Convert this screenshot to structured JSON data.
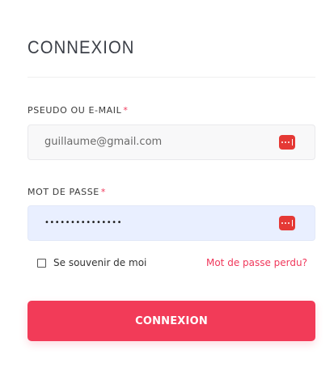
{
  "form": {
    "title": "CONNEXION",
    "username": {
      "label": "PSEUDO OU E-MAIL",
      "required_mark": "*",
      "value": "guillaume@gmail.com",
      "icon": "password-manager-icon"
    },
    "password": {
      "label": "MOT DE PASSE",
      "required_mark": "*",
      "value": "•••••••••••••••",
      "icon": "password-manager-icon"
    },
    "remember_me": {
      "label": "Se souvenir de moi",
      "checked": false
    },
    "forgot_password": "Mot de passe perdu?",
    "submit_label": "CONNEXION"
  },
  "colors": {
    "accent": "#f23b58",
    "title": "#3b3f47",
    "password_field_bg": "#e9efff",
    "icon_red": "#e53935"
  }
}
